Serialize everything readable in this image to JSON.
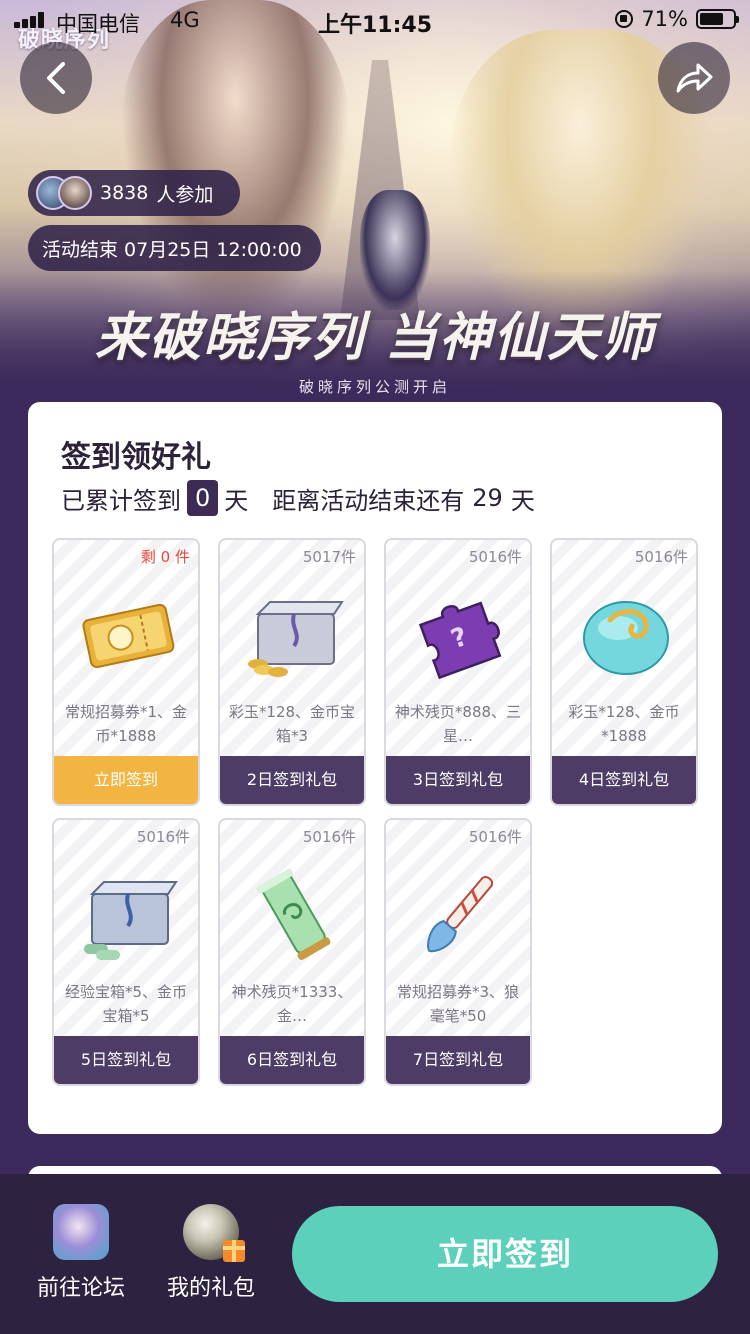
{
  "status_bar": {
    "carrier": "中国电信",
    "network": "4G",
    "time": "上午11:45",
    "battery": "71%",
    "battery_level": 0.71
  },
  "banner": {
    "brand_mark": "破晓序列",
    "participants_count": "3838",
    "participants_suffix": "人参加",
    "end_label": "活动结束 07月25日 12:00:00",
    "headline": "来破晓序列 当神仙天师",
    "subtitle": "破晓序列公测开启",
    "icons": {
      "back": "back-arrow-icon",
      "share": "share-icon"
    }
  },
  "signin": {
    "title": "签到领好礼",
    "progress_prefix": "已累计签到",
    "days_signed": "0",
    "days_unit": "天",
    "remaining_prefix": "距离活动结束还有",
    "remaining_days": "29",
    "remaining_unit": "天",
    "gifts": [
      {
        "stock": "剩 0 件",
        "stock_red": true,
        "desc": "常规招募券*1、金币*1888",
        "button": "立即签到",
        "active": true,
        "art": "ticket"
      },
      {
        "stock": "5017件",
        "stock_red": false,
        "desc": "彩玉*128、金币宝箱*3",
        "button": "2日签到礼包",
        "active": false,
        "art": "chest-gold"
      },
      {
        "stock": "5016件",
        "stock_red": false,
        "desc": "神术残页*888、三星…",
        "button": "3日签到礼包",
        "active": false,
        "art": "puzzle"
      },
      {
        "stock": "5016件",
        "stock_red": false,
        "desc": "彩玉*128、金币*1888",
        "button": "4日签到礼包",
        "active": false,
        "art": "jade"
      },
      {
        "stock": "5016件",
        "stock_red": false,
        "desc": "经验宝箱*5、金币宝箱*5",
        "button": "5日签到礼包",
        "active": false,
        "art": "chest-scroll"
      },
      {
        "stock": "5016件",
        "stock_red": false,
        "desc": "神术残页*1333、金…",
        "button": "6日签到礼包",
        "active": false,
        "art": "scroll"
      },
      {
        "stock": "5016件",
        "stock_red": false,
        "desc": "常规招募券*3、狼毫笔*50",
        "button": "7日签到礼包",
        "active": false,
        "art": "brush"
      }
    ]
  },
  "bottom_bar": {
    "forum_label": "前往论坛",
    "gifts_label": "我的礼包",
    "cta_label": "立即签到"
  },
  "colors": {
    "accent_teal": "#5dd0bc",
    "active_gold": "#f2b541",
    "button_purple": "#4d3d66",
    "stock_red": "#e8483a"
  }
}
